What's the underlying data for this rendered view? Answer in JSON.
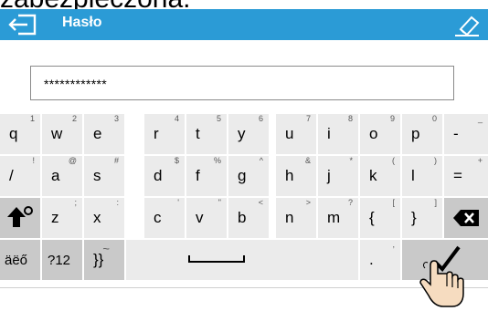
{
  "top_text": "zabezpieczona.",
  "header": {
    "title": "Hasło"
  },
  "input": {
    "value": "************"
  },
  "keyboard": {
    "row1": [
      {
        "main": "q",
        "sup": "1"
      },
      {
        "main": "w",
        "sup": "2"
      },
      {
        "main": "e",
        "sup": "3"
      },
      {
        "main": "r",
        "sup": "4"
      },
      {
        "main": "t",
        "sup": "5"
      },
      {
        "main": "y",
        "sup": "6"
      },
      {
        "main": "u",
        "sup": "7"
      },
      {
        "main": "i",
        "sup": "8"
      },
      {
        "main": "o",
        "sup": "9"
      },
      {
        "main": "p",
        "sup": "0"
      },
      {
        "main": "-",
        "sup": "_"
      }
    ],
    "row2": [
      {
        "main": "/",
        "sup": "!"
      },
      {
        "main": "a",
        "sup": "@"
      },
      {
        "main": "s",
        "sup": "#"
      },
      {
        "main": "d",
        "sup": "$"
      },
      {
        "main": "f",
        "sup": "%"
      },
      {
        "main": "g",
        "sup": "^"
      },
      {
        "main": "h",
        "sup": "&"
      },
      {
        "main": "j",
        "sup": "*"
      },
      {
        "main": "k",
        "sup": "("
      },
      {
        "main": "l",
        "sup": ")"
      },
      {
        "main": "=",
        "sup": "+"
      }
    ],
    "row3": [
      {
        "main": "z",
        "sup": ";"
      },
      {
        "main": "x",
        "sup": ":"
      },
      {
        "main": "c",
        "sup": "'"
      },
      {
        "main": "v",
        "sup": "\""
      },
      {
        "main": "b",
        "sup": "<"
      },
      {
        "main": "n",
        "sup": ">"
      },
      {
        "main": "m",
        "sup": "?"
      },
      {
        "main": "{",
        "sup": "["
      },
      {
        "main": "}",
        "sup": "]"
      }
    ],
    "row4": {
      "accents_label": "äëő",
      "numbers_label": "?12",
      "braces_label": "}}",
      "braces_sup": "~",
      "dot_label": ".",
      "dot_sup": ","
    }
  },
  "icons": {
    "back": "back-arrow-icon",
    "eraser": "eraser-icon",
    "shift": "shift-icon",
    "backspace": "backspace-icon",
    "space": "space-icon",
    "enter": "checkmark-icon",
    "hand": "hand-pointer-icon"
  },
  "colors": {
    "header": "#2b9bd6",
    "key": "#ebebeb",
    "key_dark": "#c9c9c9"
  }
}
